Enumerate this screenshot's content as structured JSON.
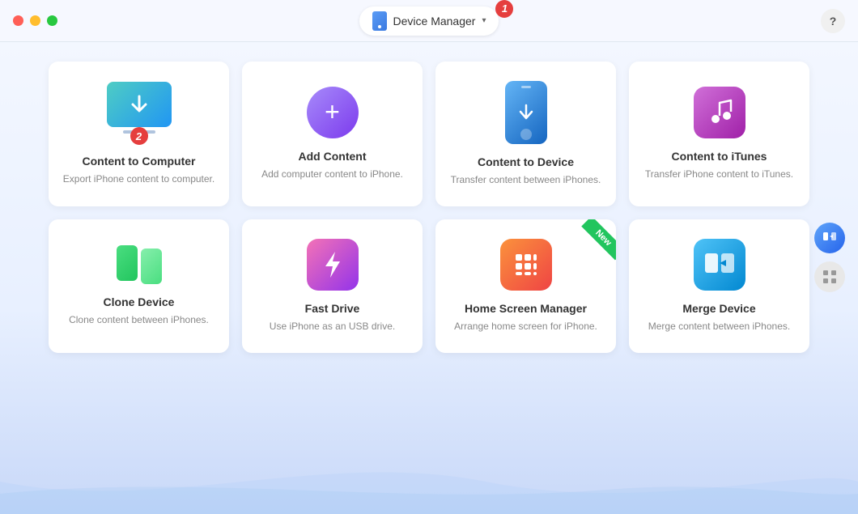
{
  "titlebar": {
    "title": "Device Manager",
    "help_label": "?",
    "badge1": "1"
  },
  "cards": [
    {
      "id": "content-to-computer",
      "title": "Content to Computer",
      "desc": "Export iPhone content to computer.",
      "badge": "2"
    },
    {
      "id": "add-content",
      "title": "Add Content",
      "desc": "Add computer content to iPhone."
    },
    {
      "id": "content-to-device",
      "title": "Content to Device",
      "desc": "Transfer content between iPhones."
    },
    {
      "id": "content-to-itunes",
      "title": "Content to iTunes",
      "desc": "Transfer iPhone content to iTunes."
    },
    {
      "id": "clone-device",
      "title": "Clone Device",
      "desc": "Clone content between iPhones."
    },
    {
      "id": "fast-drive",
      "title": "Fast Drive",
      "desc": "Use iPhone as an USB drive."
    },
    {
      "id": "home-screen-manager",
      "title": "Home Screen Manager",
      "desc": "Arrange home screen for iPhone.",
      "badge": "New"
    },
    {
      "id": "merge-device",
      "title": "Merge Device",
      "desc": "Merge content between iPhones."
    }
  ],
  "sidebar": {
    "btn1_icon": "transfer-icon",
    "btn2_icon": "grid-icon"
  }
}
